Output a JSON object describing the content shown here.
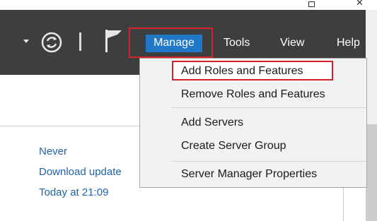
{
  "toolbar": {
    "menus": [
      {
        "label": "Manage"
      },
      {
        "label": "Tools"
      },
      {
        "label": "View"
      },
      {
        "label": "Help"
      }
    ]
  },
  "manage_menu": {
    "items": [
      {
        "label": "Add Roles and Features"
      },
      {
        "label": "Remove Roles and Features"
      },
      {
        "label": "Add Servers"
      },
      {
        "label": "Create Server Group"
      },
      {
        "label": "Server Manager Properties"
      }
    ]
  },
  "content": {
    "links": [
      {
        "text": "Never"
      },
      {
        "text": "Download update"
      },
      {
        "text": "Today at 21:09"
      }
    ]
  },
  "colors": {
    "toolbar_bg": "#3e3e3e",
    "menu_highlight": "#1f78c8",
    "callout_red": "#d2232a",
    "link_blue": "#1f63a8"
  }
}
